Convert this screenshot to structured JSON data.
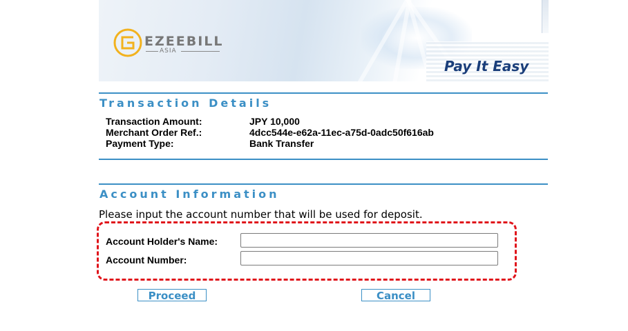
{
  "header": {
    "logo_text": "EZEEBILL",
    "logo_sub": "ASIA",
    "tagline": "Pay It Easy"
  },
  "transaction": {
    "title": "Transaction Details",
    "rows": [
      {
        "label": "Transaction Amount:",
        "value": "JPY 10,000"
      },
      {
        "label": "Merchant Order Ref.:",
        "value": "4dcc544e-e62a-11ec-a75d-0adc50f616ab"
      },
      {
        "label": "Payment Type:",
        "value": "Bank Transfer"
      }
    ]
  },
  "account": {
    "title": "Account Information",
    "prompt": "Please input the account number that will be used for deposit.",
    "holder_label": "Account Holder's Name:",
    "holder_value": "",
    "number_label": "Account Number:",
    "number_value": ""
  },
  "buttons": {
    "proceed": "Proceed",
    "cancel": "Cancel"
  },
  "colors": {
    "accent": "#3b8fc5",
    "highlight": "#e0141b",
    "tagline": "#1a3e7a",
    "logo_ring": "#f2b21e"
  }
}
